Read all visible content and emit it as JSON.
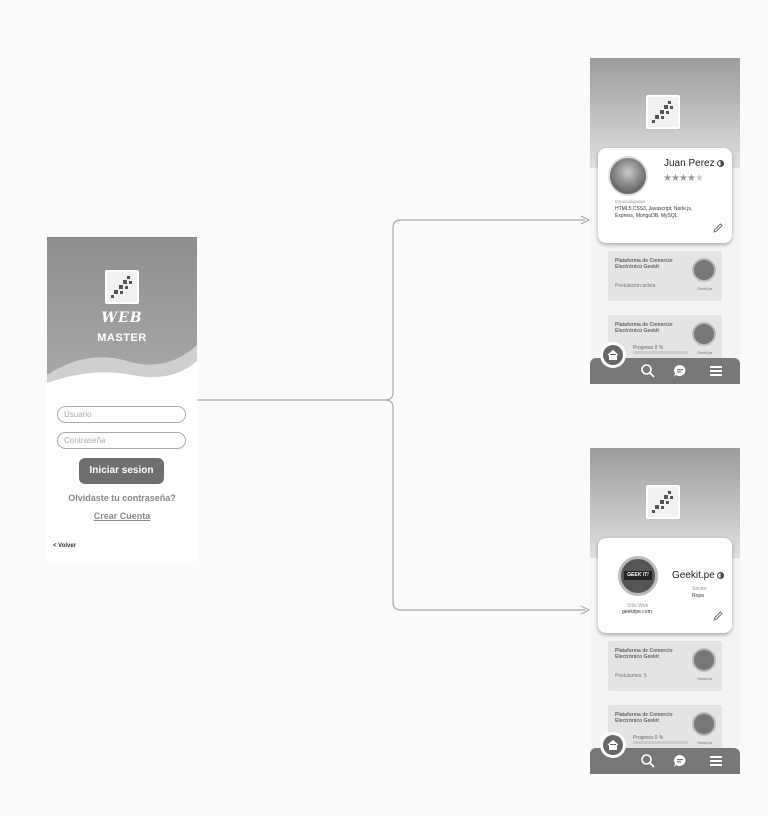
{
  "login": {
    "brand_web": "WEB",
    "brand_master": "MASTER",
    "user_placeholder": "Usuario",
    "password_placeholder": "Contraseña",
    "login_button": "Iniciar sesion",
    "forgot_link": "Olvidaste tu contraseña?",
    "create_link": "Crear Cuenta",
    "back_link": "< Volver"
  },
  "developer_profile": {
    "name": "Juan Perez",
    "rating_filled": "★★★★",
    "rating_empty": "★",
    "skills_label": "Especialidades",
    "skills": "HTML5,CSS3, Javascript, Node.js, Express, MongoDB, MySQL",
    "job1_title": "Plataforma de Comercio Electrónico Geekit",
    "job1_status": "Postulacion activa",
    "job1_logo_label": "Geekit.pe",
    "job2_title": "Plataforma de Comercio Electrónico Geekit",
    "job2_progress": "Progreso 0 %",
    "job2_logo_label": "Geekit.pe"
  },
  "company_profile": {
    "name": "Geekit.pe",
    "logo_text": "GEEK IT!",
    "sector_label": "Sector",
    "sector_value": "Ropa",
    "site_label": "Sitio Web",
    "site_value": "geekitpe.com",
    "job1_title": "Plataforma de Comercio Electrónico Geekit",
    "job1_status": "Postulantes: 5",
    "job1_logo_label": "Geekit.pe",
    "job2_title": "Plataforma de Comercio Electrónico Geekit",
    "job2_progress": "Progreso 0 %",
    "job2_logo_label": "Geekit.pe"
  },
  "icons": [
    "home-icon",
    "search-icon",
    "chat-icon",
    "menu-icon",
    "edit-icon",
    "logo-icon"
  ],
  "colors": {
    "header_gray": "#8a8a8a",
    "button_gray": "#6f6f6f",
    "nav_gray": "#777777"
  }
}
